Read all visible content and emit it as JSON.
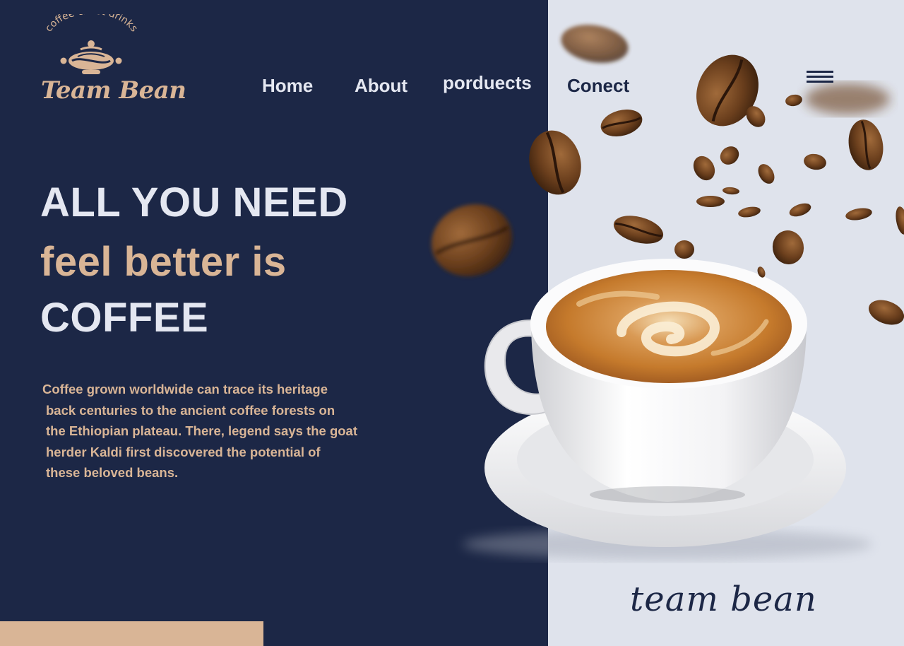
{
  "brand": {
    "tagline": "coffee & hot drinks",
    "name": "Team Bean"
  },
  "nav": {
    "home": "Home",
    "about": "About",
    "products": "porduects",
    "connect": "Conect",
    "menu_icon": "hamburger-menu-icon"
  },
  "hero": {
    "line1": "ALL YOU NEED",
    "line2": "feel better is",
    "line3": "COFFEE",
    "description_lines": [
      "Coffee grown worldwide can trace its heritage",
      "back centuries to the ancient coffee forests on",
      "the Ethiopian plateau. There, legend says the goat",
      "herder Kaldi first discovered the potential of",
      "these beloved beans."
    ]
  },
  "signature": "team bean",
  "colors": {
    "navy": "#1c2746",
    "tan": "#d9b596",
    "light": "#dfe3ec",
    "off_white": "#e4e7f1"
  }
}
